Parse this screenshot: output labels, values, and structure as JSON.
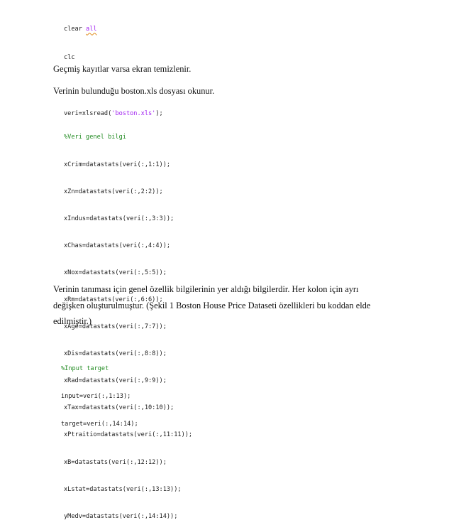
{
  "code_block_1": {
    "line1_kw": "clear ",
    "line1_arg": "all",
    "line2": "clc",
    "line3_prefix": "veri=xlsread(",
    "line3_str": "'boston.xls'",
    "line3_suffix": ");"
  },
  "paragraph_1": "Geçmiş kayıtlar varsa ekran temizlenir.",
  "paragraph_2": "Verinin bulunduğu boston.xls dosyası okunur.",
  "code_block_2": {
    "comment": "%Veri genel bilgi",
    "lines": [
      "xCrim=datastats(veri(:,1:1));",
      "xZn=datastats(veri(:,2:2));",
      "xIndus=datastats(veri(:,3:3));",
      "xChas=datastats(veri(:,4:4));",
      "xNox=datastats(veri(:,5:5));",
      "xRm=datastats(veri(:,6:6));",
      "xAge=datastats(veri(:,7:7));",
      "xDis=datastats(veri(:,8:8));",
      "xRad=datastats(veri(:,9:9));",
      "xTax=datastats(veri(:,10:10));",
      "xPtraitio=datastats(veri(:,11:11));",
      "xB=datastats(veri(:,12:12));",
      "xLstat=datastats(veri(:,13:13));",
      "yMedv=datastats(veri(:,14:14));"
    ]
  },
  "paragraph_3": {
    "line1": "Verinin tanıması için genel özellik bilgilerinin yer aldığı bilgilerdir. Her kolon için ayrı",
    "line2": "değişken oluşturulmuştur. (Şekil 1 Boston House Price Dataseti özellikleri bu koddan elde",
    "line3": "edilmiştir.)"
  },
  "code_block_3": {
    "comment": "%Input target",
    "line1": "input=veri(:,1:13);",
    "line2": "target=veri(:,14:14);"
  }
}
